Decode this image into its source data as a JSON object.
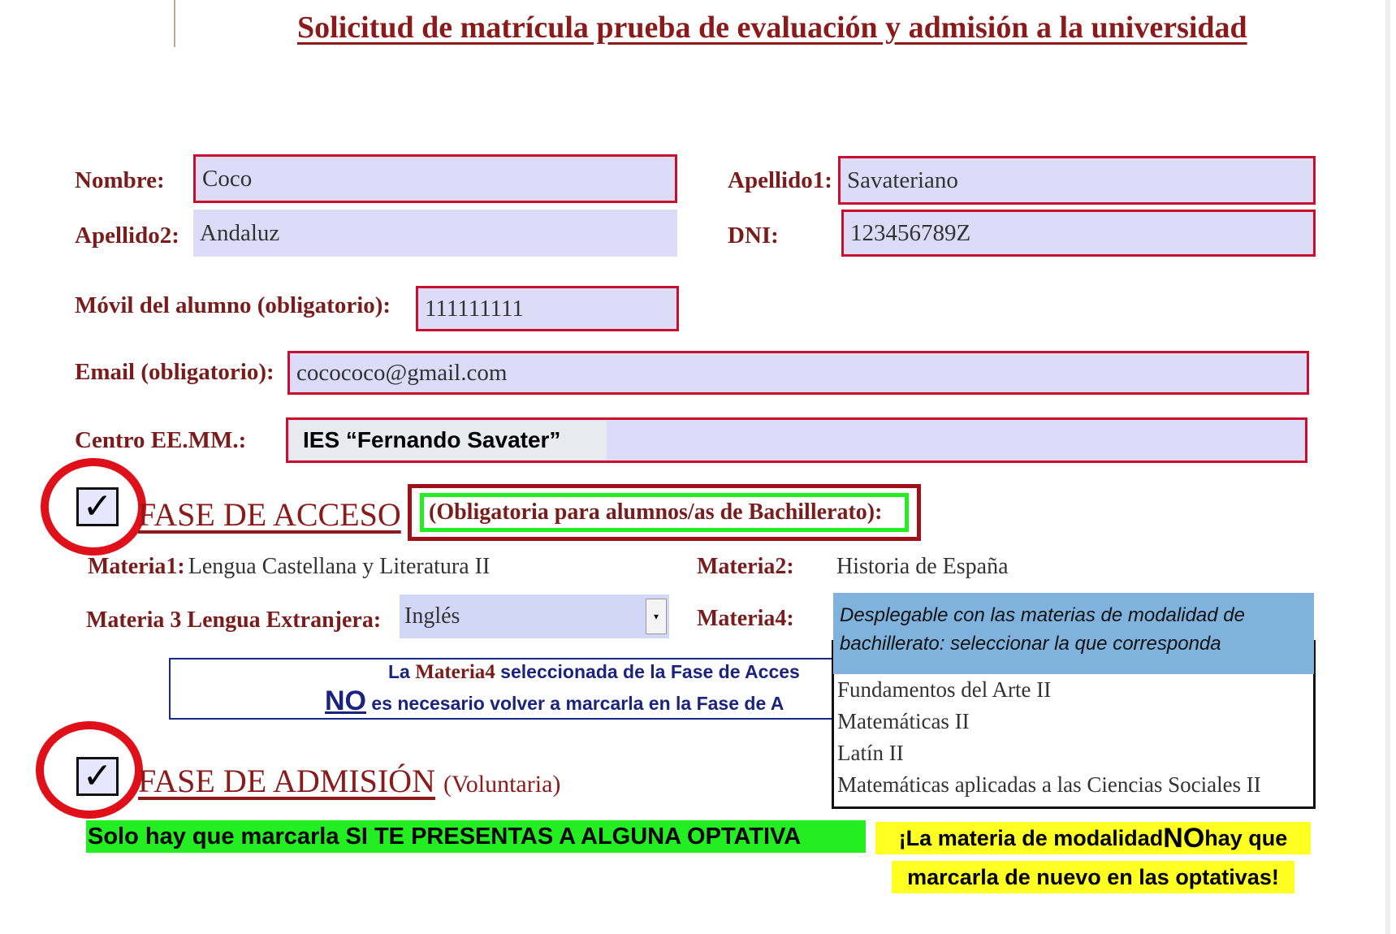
{
  "title": "Solicitud de matrícula prueba de evaluación y admisión a la universidad",
  "form": {
    "nombre_label": "Nombre:",
    "nombre_value": "Coco",
    "apellido1_label": "Apellido1:",
    "apellido1_value": "Savateriano",
    "apellido2_label": "Apellido2:",
    "apellido2_value": "Andaluz",
    "dni_label": "DNI:",
    "dni_value": "123456789Z",
    "movil_label": "Móvil del alumno (obligatorio):",
    "movil_value": "111111111",
    "email_label": "Email (obligatorio):",
    "email_value": "cocococo@gmail.com",
    "centro_label": "Centro EE.MM.:",
    "centro_value": "IES “Fernando Savater”"
  },
  "fase_acceso": {
    "checked": true,
    "check_glyph": "✓",
    "title": "FASE DE ACCESO",
    "note": "(Obligatoria para alumnos/as de Bachillerato):",
    "materia1_label": "Materia1:",
    "materia1_value": "Lengua Castellana y Literatura II",
    "materia2_label": "Materia2:",
    "materia2_value": "Historia de España",
    "materia3_label": "Materia 3 Lengua Extranjera:",
    "materia3_value": "Inglés",
    "materia4_label": "Materia4:"
  },
  "notice": {
    "line1_prefix": "La ",
    "line1_bold": "Materia4",
    "line1_suffix": " seleccionada de la Fase de Acces",
    "line2_no": "NO",
    "line2_rest": " es necesario volver a marcarla en la Fase de A"
  },
  "dropdown": {
    "hint": "Desplegable con las materias de modalidad de bachillerato: seleccionar la que corresponda",
    "options": [
      "Fundamentos del Arte II",
      "Matemáticas II",
      "Latín II",
      "Matemáticas aplicadas a las Ciencias Sociales II"
    ]
  },
  "fase_admision": {
    "checked": true,
    "check_glyph": "✓",
    "title": "FASE DE ADMISIÓN",
    "note": "(Voluntaria)"
  },
  "callouts": {
    "green": "Solo hay que marcarla SI TE PRESENTAS A ALGUNA OPTATIVA",
    "yellow_line1_prefix": "¡La materia de modalidad ",
    "yellow_line1_no": "NO",
    "yellow_line1_suffix": " hay que",
    "yellow_line2": "marcarla de nuevo en las optativas!"
  },
  "colors": {
    "title": "#8b1a1a",
    "field_bg": "#dcdcf8",
    "field_border": "#c8102e",
    "highlight_green": "#22ee22",
    "highlight_yellow": "#ffff22",
    "hint_blue": "#7fb3dd"
  }
}
